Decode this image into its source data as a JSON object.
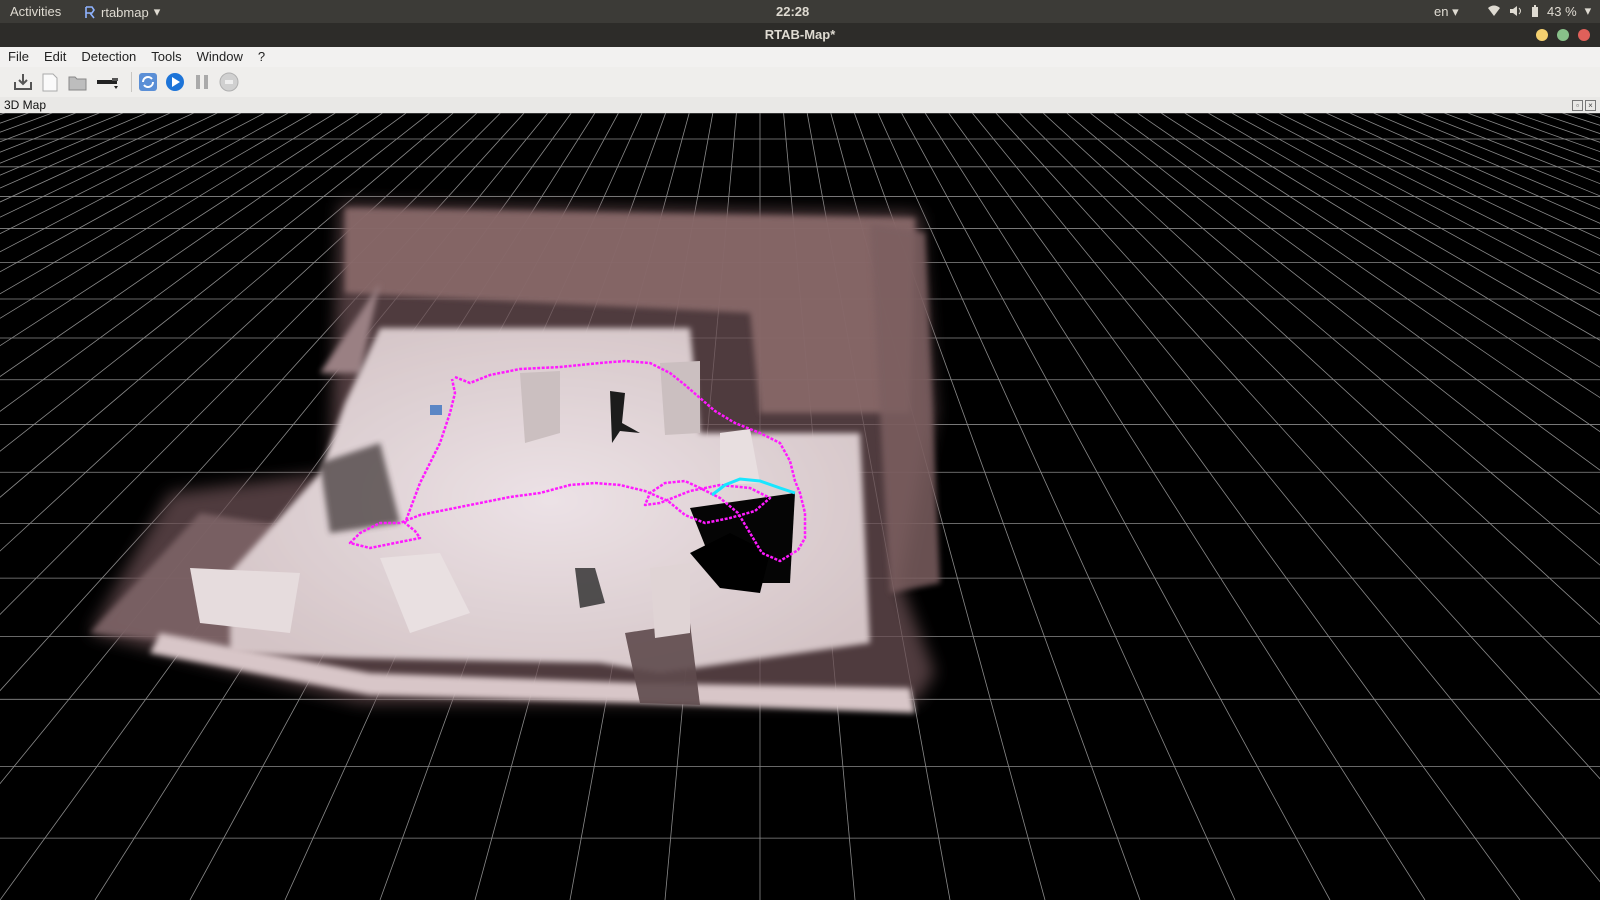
{
  "system_bar": {
    "activities": "Activities",
    "app_name": "rtabmap",
    "clock": "22:28",
    "language": "en",
    "battery": "43 %"
  },
  "window": {
    "title": "RTAB-Map*"
  },
  "menu": {
    "items": [
      "File",
      "Edit",
      "Detection",
      "Tools",
      "Window",
      "?"
    ]
  },
  "toolbar": {
    "buttons": [
      "import-icon",
      "new-database-icon",
      "open-database-icon",
      "source-selector-icon",
      "refresh-icon",
      "start-icon",
      "pause-icon",
      "stop-icon"
    ]
  },
  "dock": {
    "title": "3D Map"
  },
  "colors": {
    "trajectory": "#ff1aff",
    "current_trajectory": "#19e6ff",
    "grid": "#8a8a8a",
    "background": "#000000"
  }
}
